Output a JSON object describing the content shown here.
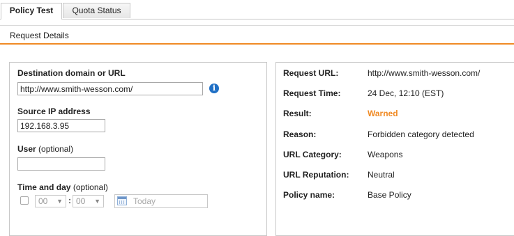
{
  "tabs": [
    {
      "label": "Policy Test",
      "active": true
    },
    {
      "label": "Quota Status",
      "active": false
    }
  ],
  "section": {
    "title": "Request Details"
  },
  "form": {
    "destination": {
      "label": "Destination domain or URL",
      "value": "http://www.smith-wesson.com/"
    },
    "source_ip": {
      "label": "Source IP address",
      "value": "192.168.3.95"
    },
    "user": {
      "label": "User",
      "optional": "(optional)",
      "value": ""
    },
    "time_day": {
      "label": "Time and day",
      "optional": "(optional)",
      "enabled": false,
      "hour": "00",
      "minute": "00",
      "separator": ":",
      "date_placeholder": "Today"
    }
  },
  "result": {
    "rows": [
      {
        "label": "Request URL:",
        "value": "http://www.smith-wesson.com/"
      },
      {
        "label": "Request Time:",
        "value": "24 Dec, 12:10 (EST)"
      },
      {
        "label": "Result:",
        "value": "Warned"
      },
      {
        "label": "Reason:",
        "value": "Forbidden category detected"
      },
      {
        "label": "URL Category:",
        "value": "Weapons"
      },
      {
        "label": "URL Reputation:",
        "value": "Neutral"
      },
      {
        "label": "Policy name:",
        "value": "Base Policy"
      }
    ]
  },
  "colors": {
    "accent": "#f08a24",
    "info": "#1f6fc5"
  },
  "icons": [
    "info-icon",
    "calendar-icon",
    "chevron-down-icon",
    "checkbox"
  ]
}
